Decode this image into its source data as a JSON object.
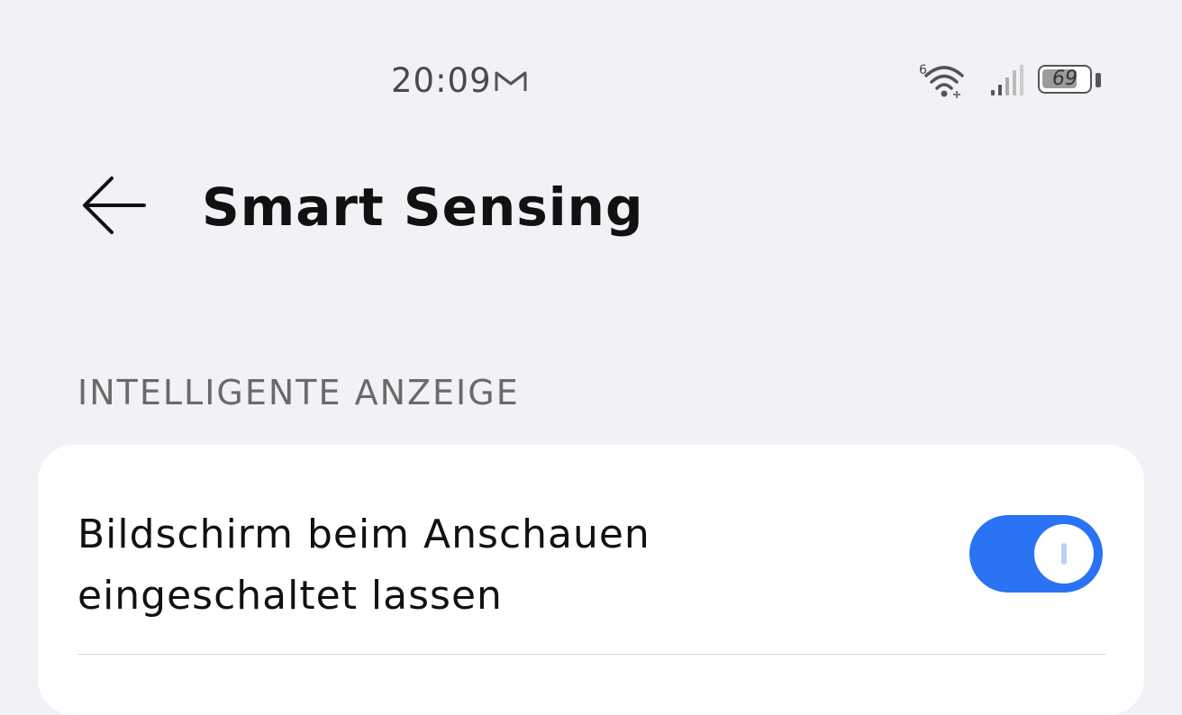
{
  "status_bar": {
    "time": "20:09",
    "notification_icon": "gmail-icon",
    "wifi_icon": "wifi-icon",
    "wifi_badge": "6",
    "signal_icon": "cellular-signal-icon",
    "battery_level": "69"
  },
  "header": {
    "back_icon": "arrow-left-icon",
    "title": "Smart Sensing"
  },
  "section": {
    "header": "INTELLIGENTE ANZEIGE"
  },
  "settings": [
    {
      "label": "Bildschirm beim Anschauen eingeschaltet lassen",
      "enabled": true
    }
  ],
  "colors": {
    "background": "#f1f2f6",
    "card": "#ffffff",
    "accent": "#2a73f5",
    "text_primary": "#111111",
    "text_secondary": "#6a6a6a"
  }
}
